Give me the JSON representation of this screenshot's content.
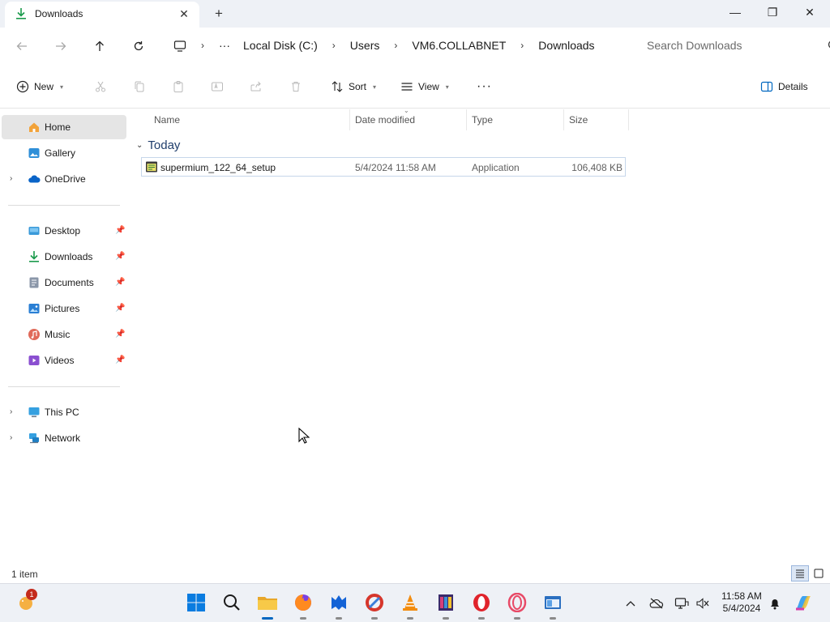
{
  "tab": {
    "title": "Downloads",
    "close": "✕",
    "new": "+"
  },
  "window": {
    "minimize": "—",
    "maximize": "❐",
    "close": "✕"
  },
  "address": {
    "more": "···",
    "crumbs": [
      "Local Disk (C:)",
      "Users",
      "VM6.COLLABNET",
      "Downloads"
    ],
    "search_placeholder": "Search Downloads"
  },
  "commands": {
    "new": "New",
    "sort": "Sort",
    "view": "View",
    "more": "···",
    "details": "Details"
  },
  "sidebar": {
    "home": "Home",
    "gallery": "Gallery",
    "onedrive": "OneDrive",
    "desktop": "Desktop",
    "downloads": "Downloads",
    "documents": "Documents",
    "pictures": "Pictures",
    "music": "Music",
    "videos": "Videos",
    "thispc": "This PC",
    "network": "Network"
  },
  "columns": {
    "name": "Name",
    "date": "Date modified",
    "type": "Type",
    "size": "Size"
  },
  "group": {
    "label": "Today"
  },
  "files": [
    {
      "name": "supermium_122_64_setup",
      "date": "5/4/2024 11:58 AM",
      "type": "Application",
      "size": "106,408 KB"
    }
  ],
  "status": {
    "count": "1 item"
  },
  "taskbar": {
    "badge": "1",
    "time": "11:58 AM",
    "date": "5/4/2024"
  },
  "colors": {
    "accent": "#0067c0",
    "selected": "#e5e5e5",
    "row_border": "#c6d6ea"
  }
}
